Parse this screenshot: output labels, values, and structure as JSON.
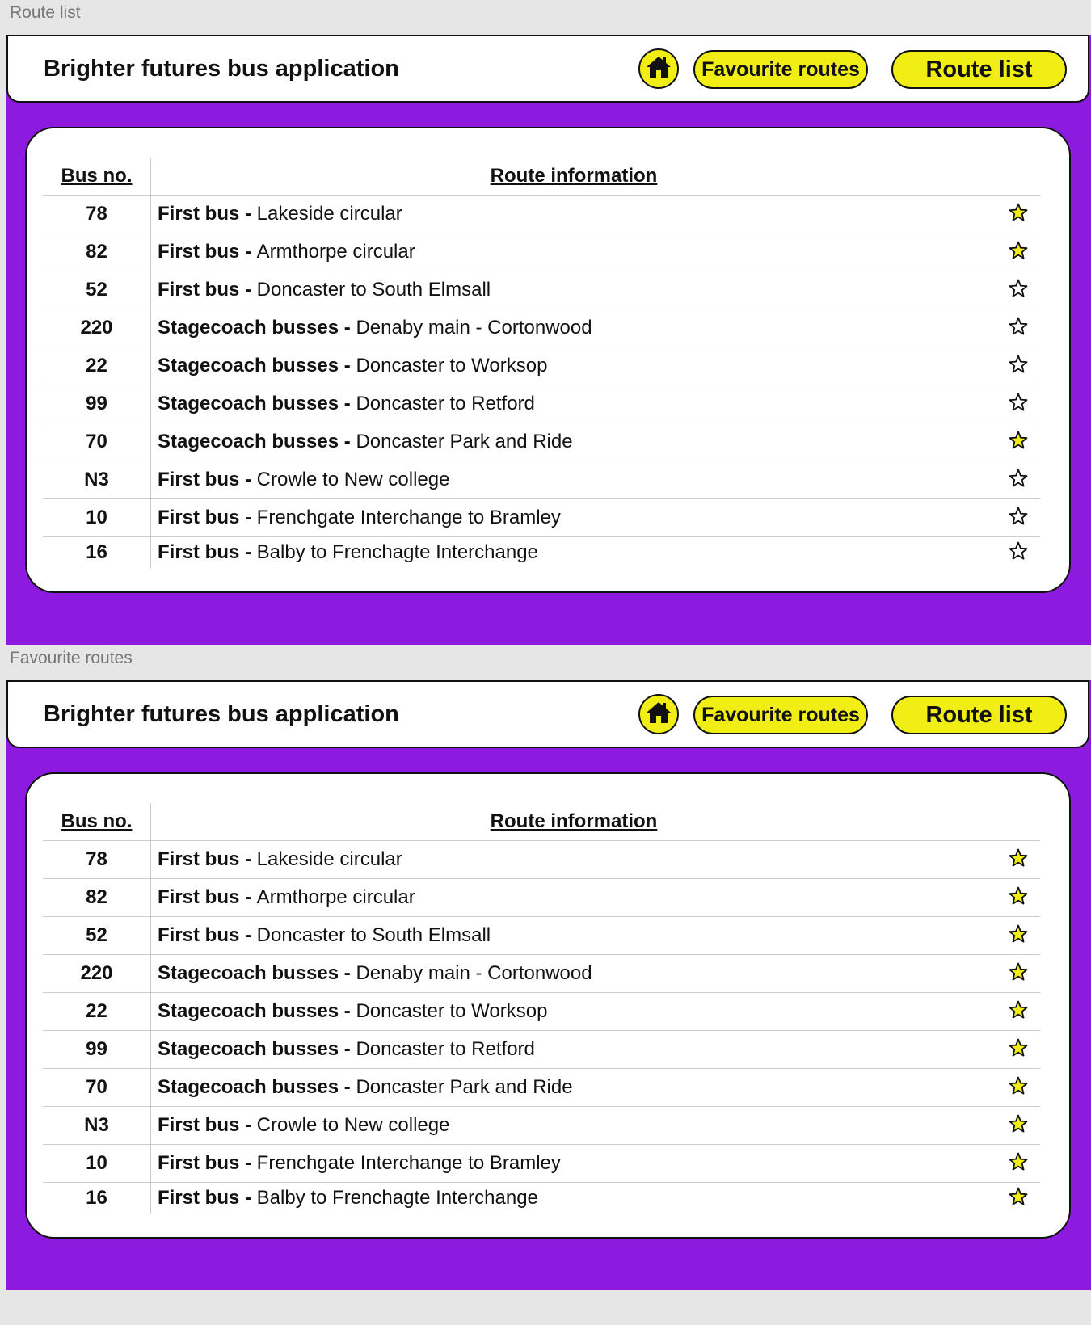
{
  "colors": {
    "brand_purple": "#8c1adf",
    "accent_yellow": "#f1ee16",
    "star_filled": "#f1ee16",
    "star_empty": "#ffffff"
  },
  "header": {
    "title": "Brighter futures bus application",
    "home_icon": "home-icon",
    "favourite_label": "Favourite routes",
    "route_list_label": "Route list"
  },
  "table": {
    "col_bus": "Bus no.",
    "col_route": "Route information"
  },
  "screens": [
    {
      "label": "Route list",
      "rows": [
        {
          "no": "78",
          "operator": "First bus",
          "sep": " - ",
          "route": "Lakeside circular",
          "favourite": true
        },
        {
          "no": "82",
          "operator": "First bus",
          "sep": " - ",
          "route": "Armthorpe circular",
          "favourite": true
        },
        {
          "no": "52",
          "operator": "First bus",
          "sep": " - ",
          "route": "Doncaster to South Elmsall",
          "favourite": false
        },
        {
          "no": "220",
          "operator": "Stagecoach busses",
          "sep": " - ",
          "route": "Denaby main - Cortonwood",
          "favourite": false
        },
        {
          "no": "22",
          "operator": "Stagecoach busses",
          "sep": " - ",
          "route": "Doncaster to Worksop",
          "favourite": false
        },
        {
          "no": "99",
          "operator": "Stagecoach busses",
          "sep": " - ",
          "route": "Doncaster to Retford",
          "favourite": false
        },
        {
          "no": "70",
          "operator": "Stagecoach busses",
          "sep": " - ",
          "route": "Doncaster Park and Ride",
          "favourite": true
        },
        {
          "no": "N3",
          "operator": "First bus",
          "sep": " - ",
          "route": "Crowle to New college",
          "favourite": false
        },
        {
          "no": "10",
          "operator": "First bus",
          "sep": " - ",
          "route": "Frenchgate Interchange to Bramley",
          "favourite": false
        },
        {
          "no": "16",
          "operator": "First bus",
          "sep": " - ",
          "route": "Balby to Frenchagte Interchange",
          "favourite": false
        }
      ]
    },
    {
      "label": "Favourite routes",
      "rows": [
        {
          "no": "78",
          "operator": "First bus",
          "sep": " - ",
          "route": "Lakeside circular",
          "favourite": true
        },
        {
          "no": "82",
          "operator": "First bus",
          "sep": " - ",
          "route": "Armthorpe circular",
          "favourite": true
        },
        {
          "no": "52",
          "operator": "First bus",
          "sep": " - ",
          "route": "Doncaster to South Elmsall",
          "favourite": true
        },
        {
          "no": "220",
          "operator": "Stagecoach busses",
          "sep": " - ",
          "route": "Denaby main - Cortonwood",
          "favourite": true
        },
        {
          "no": "22",
          "operator": "Stagecoach busses",
          "sep": " - ",
          "route": "Doncaster to Worksop",
          "favourite": true
        },
        {
          "no": "99",
          "operator": "Stagecoach busses",
          "sep": " - ",
          "route": "Doncaster to Retford",
          "favourite": true
        },
        {
          "no": "70",
          "operator": "Stagecoach busses",
          "sep": " - ",
          "route": "Doncaster Park and Ride",
          "favourite": true
        },
        {
          "no": "N3",
          "operator": "First bus",
          "sep": " - ",
          "route": "Crowle to New college",
          "favourite": true
        },
        {
          "no": "10",
          "operator": "First bus",
          "sep": " - ",
          "route": "Frenchgate Interchange to Bramley",
          "favourite": true
        },
        {
          "no": "16",
          "operator": "First bus",
          "sep": " - ",
          "route": "Balby to Frenchagte Interchange",
          "favourite": true
        }
      ]
    }
  ]
}
